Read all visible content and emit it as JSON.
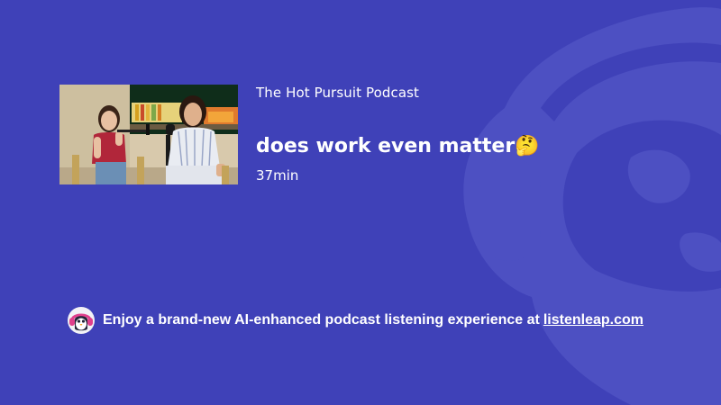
{
  "podcast": {
    "name": "The Hot Pursuit Podcast"
  },
  "episode": {
    "title": "does work even matter🤔",
    "duration": "37min"
  },
  "cover": {
    "alt_icon": "podcast-cover-image"
  },
  "promo": {
    "text": "Enjoy a brand-new AI-enhanced podcast listening experience at",
    "link_text": "listenleap.com",
    "logo_icon": "penguin-headphones-icon"
  },
  "colors": {
    "background": "#3f41b8",
    "watermark": "#5a5cc6",
    "text": "#ffffff"
  },
  "watermark_icon": "penguin-headphones-icon"
}
